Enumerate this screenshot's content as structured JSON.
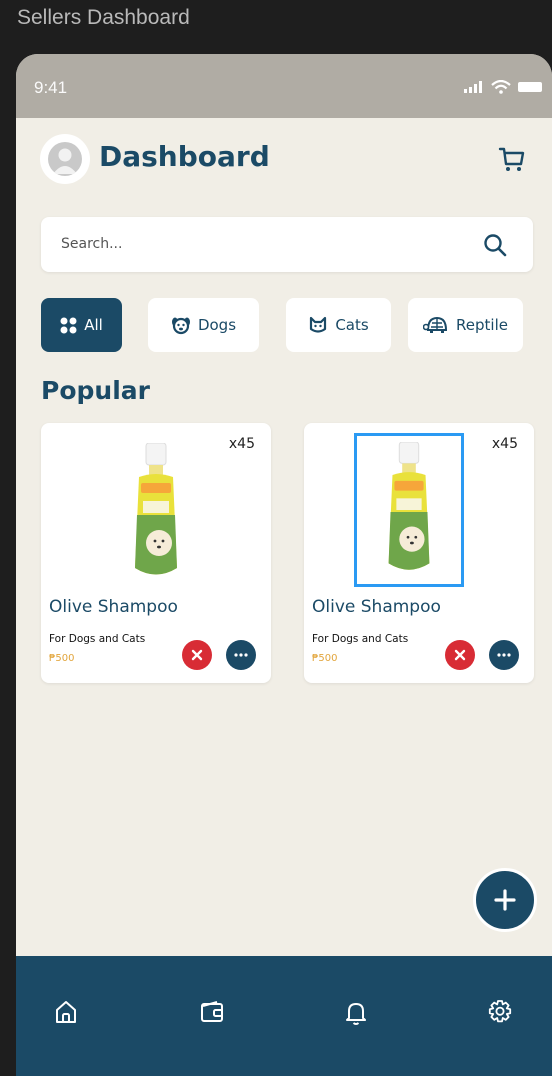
{
  "frame": {
    "title": "Sellers Dashboard"
  },
  "status_bar": {
    "time": "9:41"
  },
  "header": {
    "title": "Dashboard"
  },
  "search": {
    "placeholder": "Search..."
  },
  "categories": [
    {
      "label": "All",
      "icon": "grid-icon",
      "active": true
    },
    {
      "label": "Dogs",
      "icon": "dog-icon",
      "active": false
    },
    {
      "label": "Cats",
      "icon": "cat-icon",
      "active": false
    },
    {
      "label": "Reptile",
      "icon": "turtle-icon",
      "active": false
    }
  ],
  "section": {
    "title": "Popular"
  },
  "products": [
    {
      "name": "Olive Shampoo",
      "description": "For Dogs and Cats",
      "price": "₱500",
      "quantity": "x45",
      "selected": false
    },
    {
      "name": "Olive Shampoo",
      "description": "For Dogs and Cats",
      "price": "₱500",
      "quantity": "x45",
      "selected": true
    }
  ],
  "nav": {
    "items": [
      "home-icon",
      "wallet-icon",
      "bell-icon",
      "settings-icon"
    ]
  },
  "colors": {
    "primary": "#1b4a66",
    "background": "#f1eee6",
    "danger": "#d82c35",
    "price": "#e2a53c",
    "selection": "#2a9af3"
  }
}
